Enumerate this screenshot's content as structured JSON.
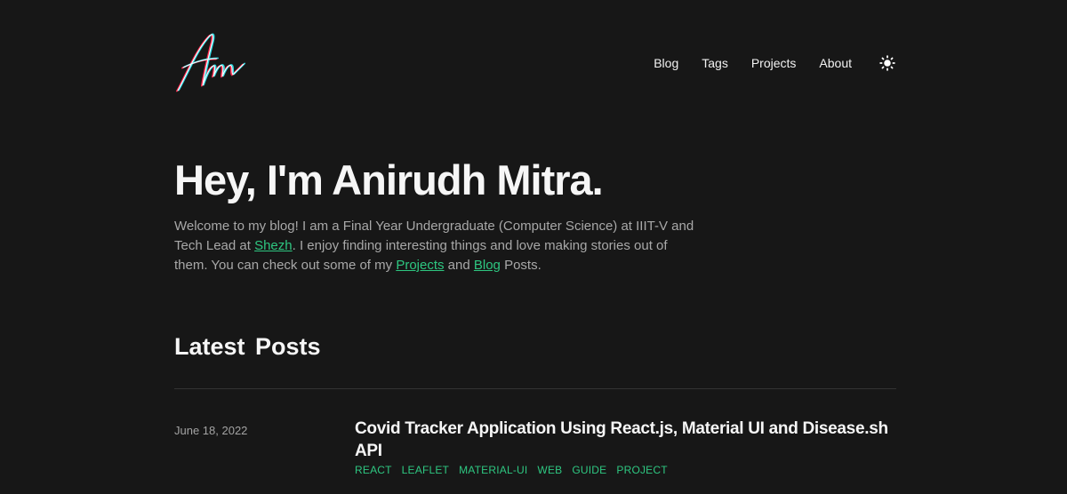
{
  "nav": {
    "items": [
      "Blog",
      "Tags",
      "Projects",
      "About"
    ],
    "theme_icon": "sun-icon"
  },
  "logo": {
    "icon": "signature-logo",
    "colors": [
      "#ff2a4f",
      "#2ad6e0",
      "#ffffff"
    ]
  },
  "hero": {
    "title": "Hey, I'm Anirudh Mitra.",
    "intro_part1": "Welcome to my blog! I am a Final Year Undergraduate (Computer Science) at IIIT-V and Tech Lead at ",
    "link_shezh": "Shezh",
    "intro_part2": ". I enjoy finding interesting things and love making stories out of them. You can check out some of my ",
    "link_projects": "Projects",
    "intro_part3": " and ",
    "link_blog": "Blog",
    "intro_part4": " Posts."
  },
  "latest": {
    "heading": "Latest Posts",
    "posts": [
      {
        "date": "June 18, 2022",
        "title": "Covid Tracker Application Using React.js, Material UI and Disease.sh API",
        "tags": [
          "REACT",
          "LEAFLET",
          "MATERIAL-UI",
          "WEB",
          "GUIDE",
          "PROJECT"
        ]
      }
    ]
  },
  "colors": {
    "background": "#171717",
    "accent": "#2ec781",
    "text": "#f6f6f6",
    "muted": "#a8a8a8"
  }
}
